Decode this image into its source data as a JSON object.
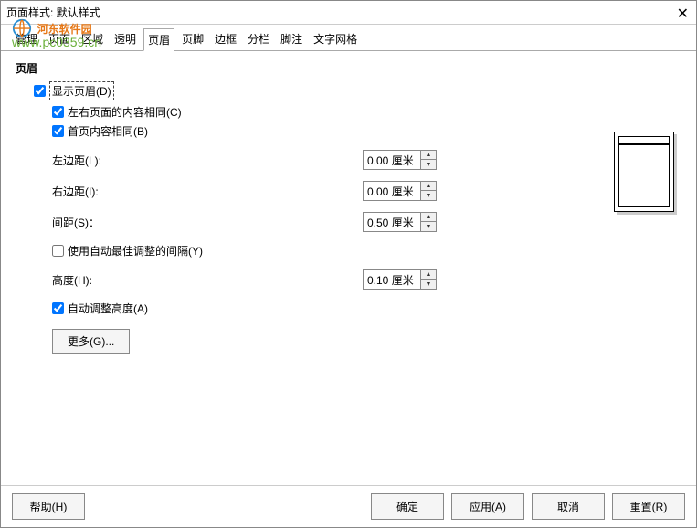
{
  "window": {
    "title": "页面样式: 默认样式"
  },
  "tabs": [
    "管理",
    "页面",
    "区域",
    "透明",
    "页眉",
    "页脚",
    "边框",
    "分栏",
    "脚注",
    "文字网格"
  ],
  "activeTab": 4,
  "section": {
    "title": "页眉"
  },
  "fields": {
    "showHeader": {
      "label": "显示页眉(D)",
      "checked": true
    },
    "sameLeftRight": {
      "label": "左右页面的内容相同(C)",
      "checked": true
    },
    "sameFirstPage": {
      "label": "首页内容相同(B)",
      "checked": true
    },
    "leftMargin": {
      "label": "左边距(L):",
      "value": "0.00 厘米"
    },
    "rightMargin": {
      "label": "右边距(I):",
      "value": "0.00 厘米"
    },
    "spacing": {
      "label": "间距(S)：",
      "value": "0.50 厘米"
    },
    "autoSpacing": {
      "label": "使用自动最佳调整的间隔(Y)",
      "checked": false
    },
    "height": {
      "label": "高度(H):",
      "value": "0.10 厘米"
    },
    "autoHeight": {
      "label": "自动调整高度(A)",
      "checked": true
    },
    "moreBtn": "更多(G)..."
  },
  "footer": {
    "help": "帮助(H)",
    "ok": "确定",
    "apply": "应用(A)",
    "cancel": "取消",
    "reset": "重置(R)"
  },
  "watermark": {
    "line1": "河东软件园",
    "line2": "www.pc0359.cn"
  }
}
